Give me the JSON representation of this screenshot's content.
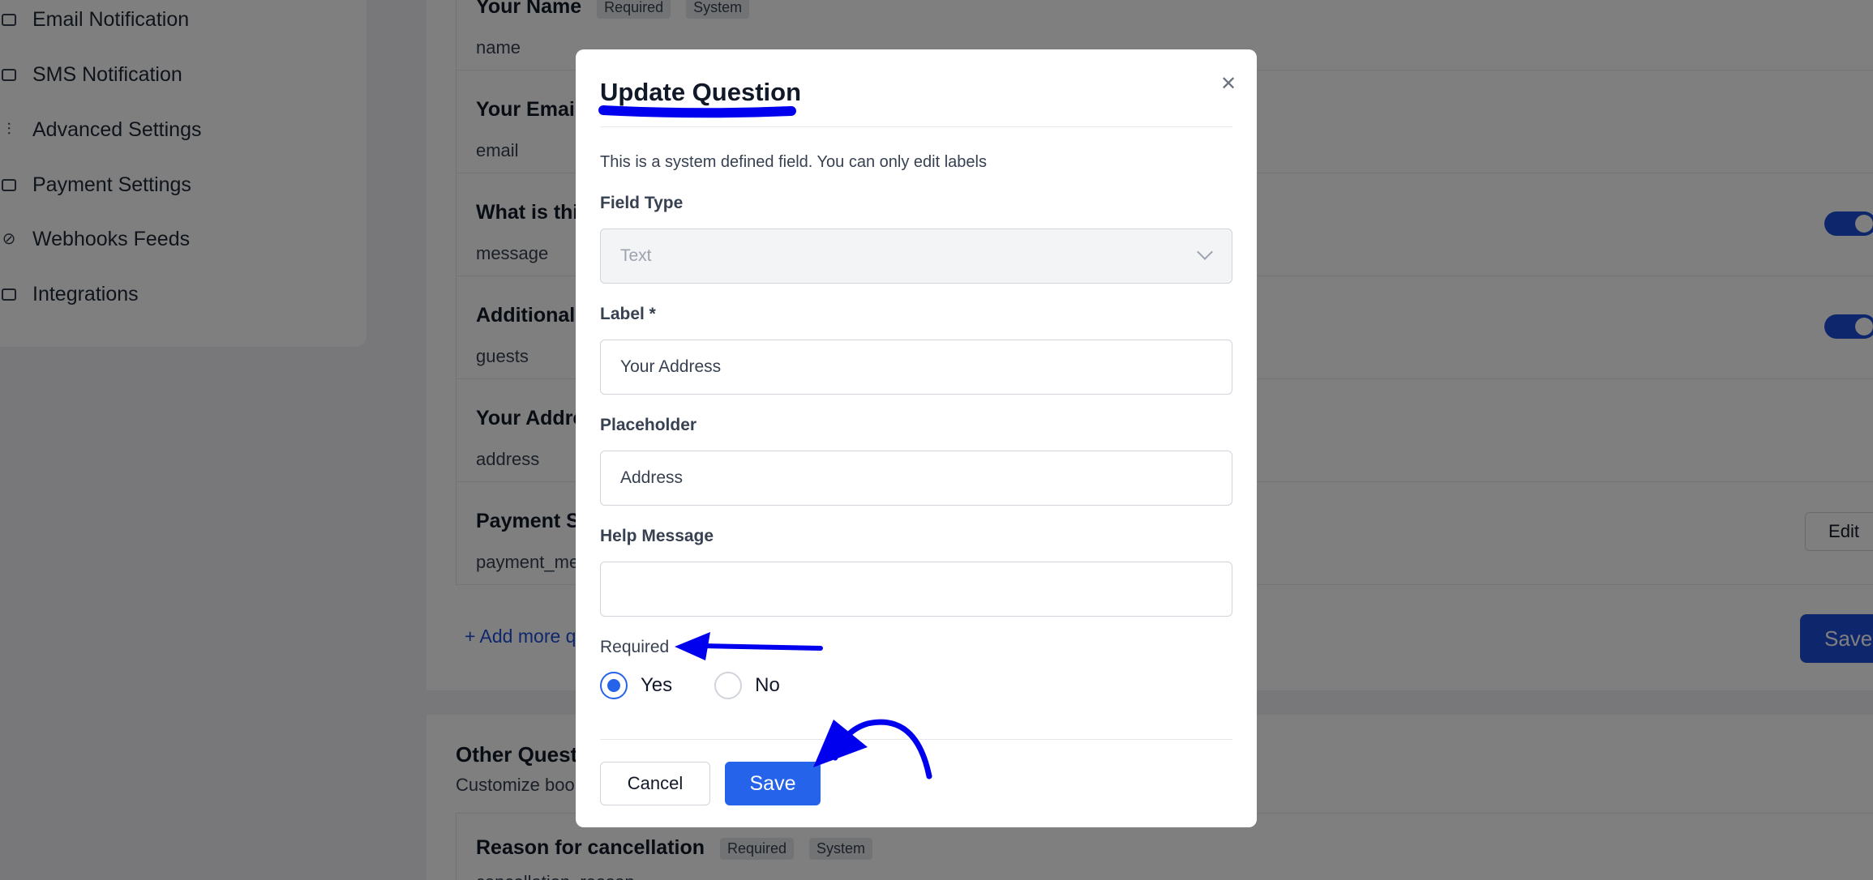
{
  "sidebar": {
    "items": [
      {
        "label": "Email Notification",
        "icon": "mail-icon"
      },
      {
        "label": "SMS Notification",
        "icon": "message-icon"
      },
      {
        "label": "Advanced Settings",
        "icon": "sliders-icon"
      },
      {
        "label": "Payment Settings",
        "icon": "payment-icon"
      },
      {
        "label": "Webhooks Feeds",
        "icon": "link-icon"
      },
      {
        "label": "Integrations",
        "icon": "integrations-icon"
      }
    ]
  },
  "questions": [
    {
      "title": "Your Name",
      "key": "name",
      "tags": [
        "Required",
        "System"
      ]
    },
    {
      "title": "Your Email",
      "key": "email"
    },
    {
      "title": "What is thi",
      "key": "message",
      "toggle": true
    },
    {
      "title": "Additional G",
      "key": "guests",
      "toggle": true
    },
    {
      "title": "Your Addre",
      "key": "address"
    },
    {
      "title": "Payment Si",
      "key": "payment_me"
    }
  ],
  "edit_label": "Edit",
  "save_label": "Save",
  "add_more_label": "+ Add more qu",
  "other_questions": {
    "title": "Other Questi",
    "subtitle": "Customize book",
    "items": [
      {
        "title": "Reason for cancellation",
        "key": "cancellation_reason",
        "tags": [
          "Required",
          "System"
        ]
      }
    ]
  },
  "modal": {
    "title": "Update Question",
    "hint": "This is a system defined field. You can only edit labels",
    "field_type_label": "Field Type",
    "field_type_value": "Text",
    "label_label": "Label *",
    "label_value": "Your Address",
    "placeholder_label": "Placeholder",
    "placeholder_value": "Address",
    "help_label": "Help Message",
    "help_value": "",
    "required_label": "Required",
    "options": [
      "Yes",
      "No"
    ],
    "selected": "Yes",
    "cancel_label": "Cancel",
    "save_label": "Save"
  },
  "colors": {
    "primary": "#2563eb",
    "annotation": "#0000ee"
  }
}
